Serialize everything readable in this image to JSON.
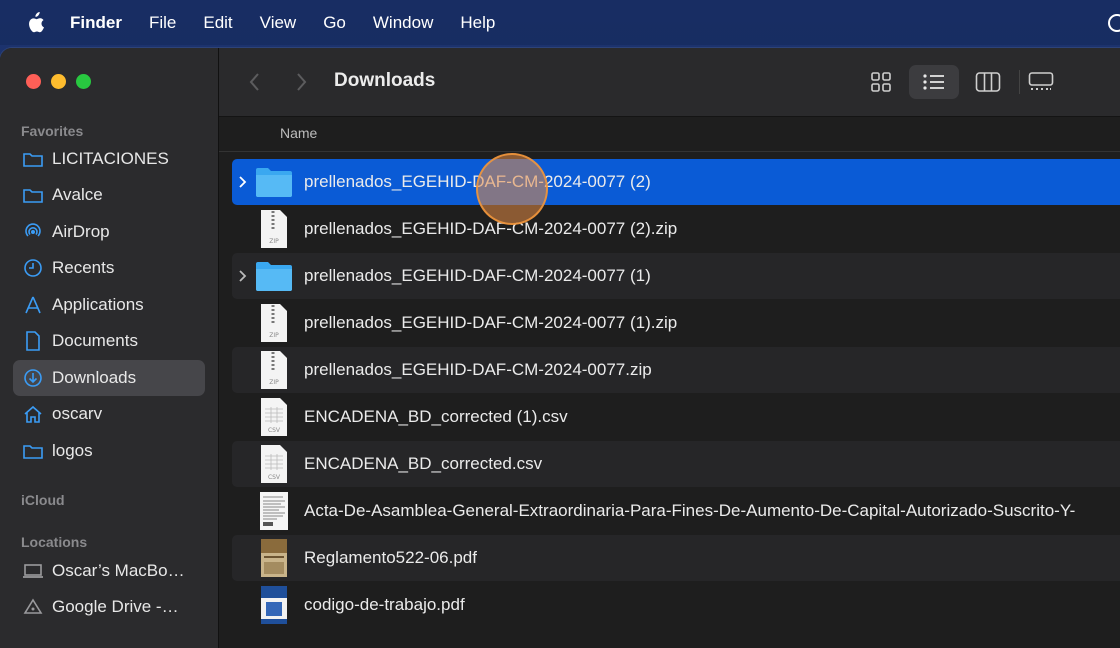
{
  "menubar": {
    "app_name": "Finder",
    "items": [
      "File",
      "Edit",
      "View",
      "Go",
      "Window",
      "Help"
    ]
  },
  "window": {
    "title": "Downloads",
    "column_header": "Name"
  },
  "sidebar": {
    "favorites_label": "Favorites",
    "icloud_label": "iCloud",
    "locations_label": "Locations",
    "favorites": [
      {
        "label": "LICITACIONES",
        "icon": "folder-icon"
      },
      {
        "label": "Avalce",
        "icon": "folder-icon"
      },
      {
        "label": "AirDrop",
        "icon": "airdrop-icon"
      },
      {
        "label": "Recents",
        "icon": "clock-icon"
      },
      {
        "label": "Applications",
        "icon": "applications-icon"
      },
      {
        "label": "Documents",
        "icon": "document-icon"
      },
      {
        "label": "Downloads",
        "icon": "download-icon",
        "selected": true
      },
      {
        "label": "oscarv",
        "icon": "home-icon"
      },
      {
        "label": "logos",
        "icon": "folder-icon"
      }
    ],
    "locations": [
      {
        "label": "Oscar’s MacBo…",
        "icon": "laptop-icon"
      },
      {
        "label": "Google Drive -…",
        "icon": "drive-icon"
      }
    ]
  },
  "files": [
    {
      "name": "prellenados_EGEHID-DAF-CM-2024-0077 (2)",
      "kind": "folder",
      "selected": true
    },
    {
      "name": "prellenados_EGEHID-DAF-CM-2024-0077 (2).zip",
      "kind": "zip"
    },
    {
      "name": "prellenados_EGEHID-DAF-CM-2024-0077 (1)",
      "kind": "folder"
    },
    {
      "name": "prellenados_EGEHID-DAF-CM-2024-0077 (1).zip",
      "kind": "zip"
    },
    {
      "name": "prellenados_EGEHID-DAF-CM-2024-0077.zip",
      "kind": "zip"
    },
    {
      "name": "ENCADENA_BD_corrected (1).csv",
      "kind": "csv"
    },
    {
      "name": "ENCADENA_BD_corrected.csv",
      "kind": "csv"
    },
    {
      "name": "Acta-De-Asamblea-General-Extraordinaria-Para-Fines-De-Aumento-De-Capital-Autorizado-Suscrito-Y-",
      "kind": "doc"
    },
    {
      "name": "Reglamento522-06.pdf",
      "kind": "pdf-brown"
    },
    {
      "name": "codigo-de-trabajo.pdf",
      "kind": "pdf-blue"
    }
  ],
  "icon_labels": {
    "zip": "ZIP",
    "csv": "CSV"
  },
  "colors": {
    "selection": "#0a5bd6",
    "folder": "#3aa8f0",
    "sidebar_icon": "#3b9cf5"
  }
}
